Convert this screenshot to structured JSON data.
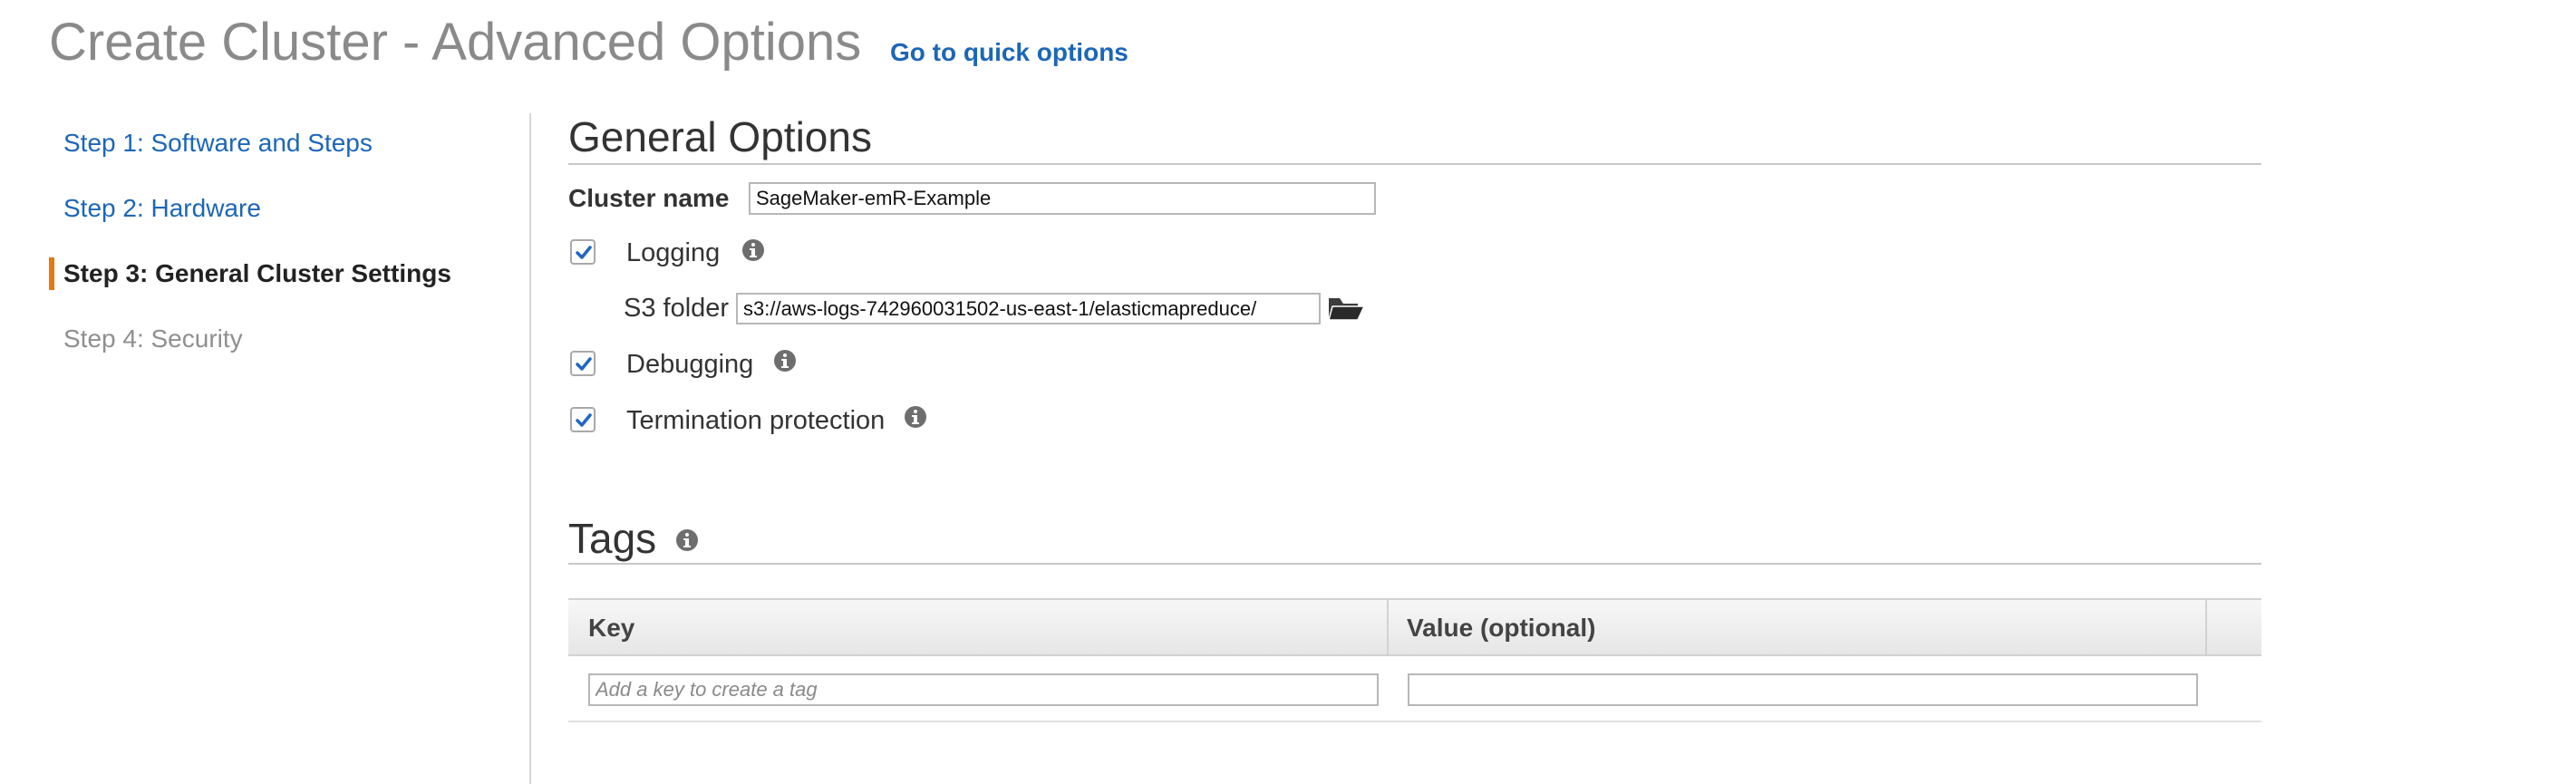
{
  "header": {
    "title": "Create Cluster - Advanced Options",
    "quick_options_link": "Go to quick options"
  },
  "sidebar": {
    "steps": [
      {
        "label": "Step 1: Software and Steps",
        "state": "link"
      },
      {
        "label": "Step 2: Hardware",
        "state": "link"
      },
      {
        "label": "Step 3: General Cluster Settings",
        "state": "active"
      },
      {
        "label": "Step 4: Security",
        "state": "disabled"
      }
    ],
    "active_color": "#e47911"
  },
  "general_options": {
    "title": "General Options",
    "cluster_name_label": "Cluster name",
    "cluster_name_value": "SageMaker-emR-Example",
    "logging": {
      "label": "Logging",
      "checked": true
    },
    "s3_folder_label": "S3 folder",
    "s3_folder_value": "s3://aws-logs-742960031502-us-east-1/elasticmapreduce/",
    "debugging": {
      "label": "Debugging",
      "checked": true
    },
    "termination_protection": {
      "label": "Termination protection",
      "checked": true
    }
  },
  "tags": {
    "title": "Tags",
    "columns": [
      "Key",
      "Value (optional)"
    ],
    "key_placeholder": "Add a key to create a tag",
    "value_value": ""
  },
  "colors": {
    "link": "#1c66b8",
    "checkbox_check": "#1f66c4",
    "icon": "#6e6e6e"
  }
}
